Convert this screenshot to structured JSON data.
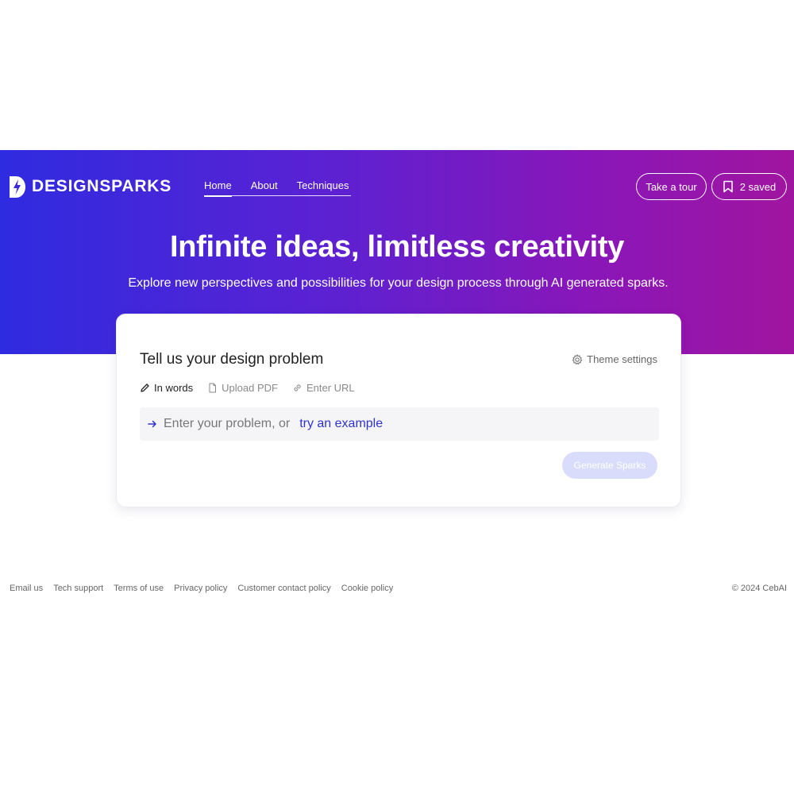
{
  "brand": {
    "name": "DESIGNSPARKS"
  },
  "nav": {
    "items": [
      {
        "label": "Home",
        "active": true
      },
      {
        "label": "About",
        "active": false
      },
      {
        "label": "Techniques",
        "active": false
      }
    ]
  },
  "header_actions": {
    "tour_label": "Take a tour",
    "saved_label": "2 saved"
  },
  "hero": {
    "title": "Infinite ideas, limitless creativity",
    "subtitle": "Explore new perspectives and possibilities for your design process through AI generated sparks."
  },
  "card": {
    "title": "Tell us your design problem",
    "theme_settings_label": "Theme settings",
    "tabs": [
      {
        "label": "In words",
        "icon": "pencil-icon",
        "active": true
      },
      {
        "label": "Upload PDF",
        "icon": "file-icon",
        "active": false
      },
      {
        "label": "Enter URL",
        "icon": "link-icon",
        "active": false
      }
    ],
    "input_prompt": "Enter your problem, or",
    "example_link": "try an example",
    "generate_label": "Generate Sparks"
  },
  "footer": {
    "links": [
      "Email us",
      "Tech support",
      "Terms of use",
      "Privacy policy",
      "Customer contact policy",
      "Cookie policy"
    ],
    "copyright": "© 2024 CebAI"
  },
  "colors": {
    "gradient_start": "#2f2be0",
    "gradient_end": "#a0159f",
    "link": "#2e34c9",
    "generate_disabled": "#d9ddfb"
  }
}
